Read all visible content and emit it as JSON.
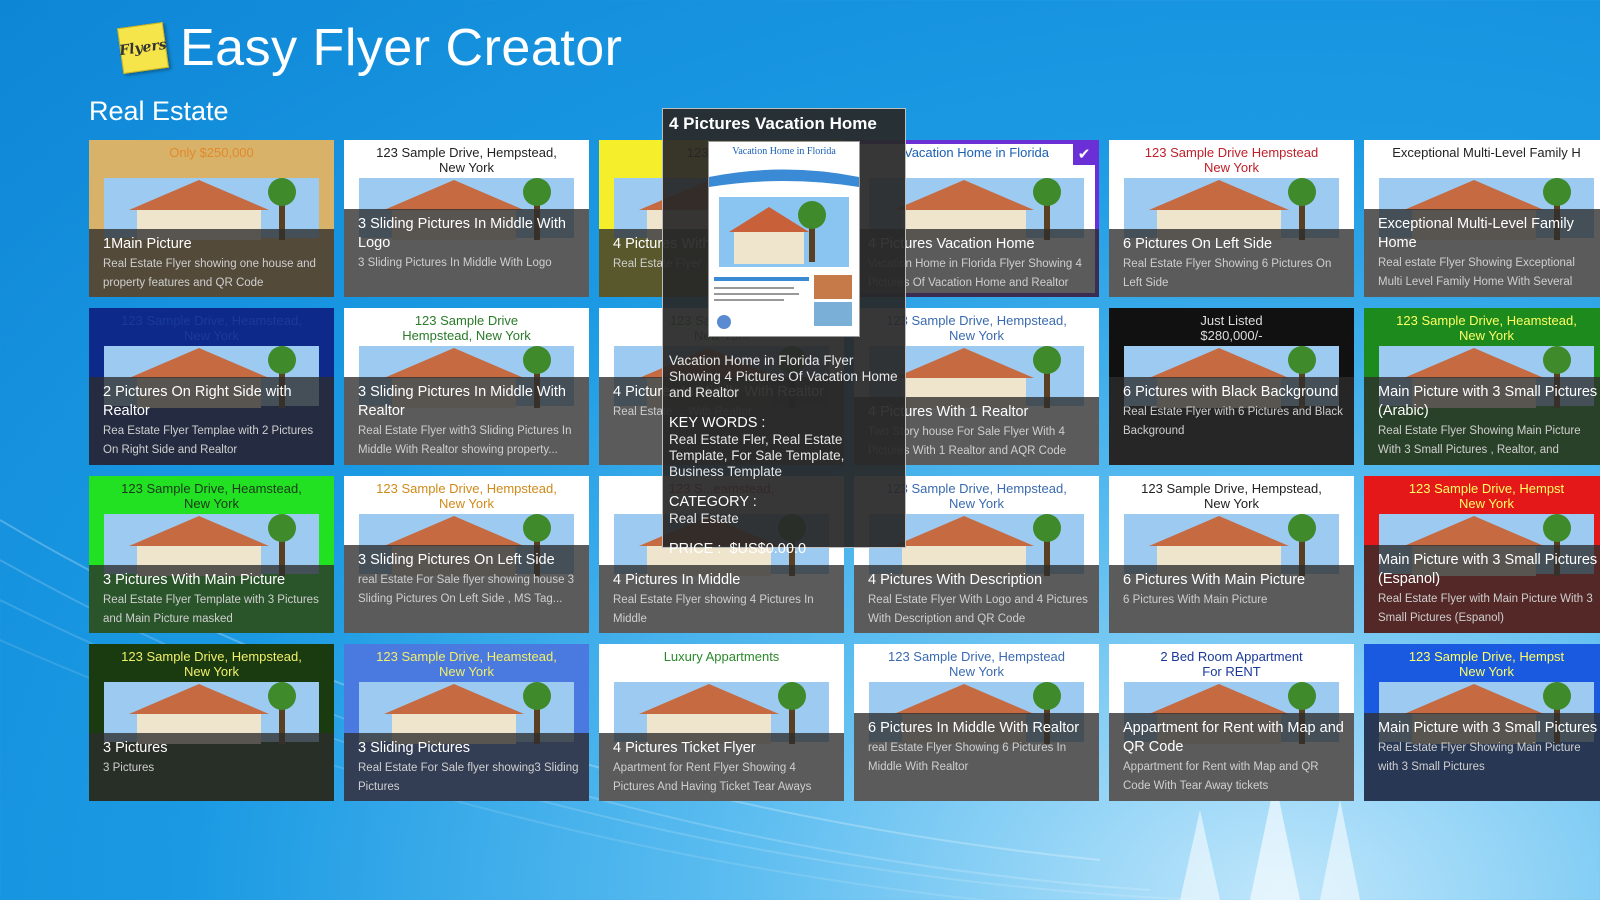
{
  "app": {
    "title": "Easy Flyer Creator",
    "logo_text": "Flyers"
  },
  "section": {
    "title": "Real Estate"
  },
  "tiles": [
    {
      "title": "1Main Picture",
      "desc": "Real Estate Flyer showing one house and property features and QR Code",
      "head": "Only $250,000",
      "bg": "#d9b26a",
      "headColor": "#e08a2a"
    },
    {
      "title": "3 Sliding Pictures In Middle With Logo",
      "desc": "3 Sliding Pictures In Middle With Logo",
      "head": "123 Sample Drive, Hempstead,\nNew York",
      "bg": "#ffffff",
      "headColor": "#222222"
    },
    {
      "title": "4 Pictures With",
      "desc": "Real Estate Flyer ... Logo and",
      "head": "123 Sample",
      "bg": "#f4ef2a",
      "headColor": "#222222"
    },
    {
      "title": "4 Pictures Vacation Home",
      "desc": "Vacation Home in Florida Flyer Showing 4 Pictures Of Vacation Home and Realtor",
      "head": "Vacation Home in Florida",
      "bg": "#ffffff",
      "headColor": "#1a5fb4",
      "selected": true
    },
    {
      "title": "6 Pictures On Left Side",
      "desc": "Real Estate Flyer Showing 6 Pictures On Left Side",
      "head": "123 Sample Drive Hempstead\nNew York",
      "bg": "#ffffff",
      "headColor": "#c0202a"
    },
    {
      "title": "Exceptional Multi-Level Family Home",
      "desc": "Real estate Flyer Showing Exceptional Multi Level Family Home With Several",
      "head": "Exceptional Multi-Level Family H",
      "bg": "#ffffff",
      "headColor": "#222222"
    },
    {
      "title": "2 Pictures On Right Side with Realtor",
      "desc": "Rea Estate Flyer Templae with 2 Pictures On Right Side and Realtor",
      "head": "123 Sample Drive, Heamstead,\nNew York",
      "bg": "#0d2a8a",
      "headColor": "#1a3a9a"
    },
    {
      "title": "3 Sliding Pictures In Middle With Realtor",
      "desc": "Real Estate Flyer with3 Sliding Pictures In Middle With Realtor showing property...",
      "head": "123 Sample Drive\nHempstead, New York",
      "bg": "#ffffff",
      "headColor": "#2a7a2a"
    },
    {
      "title": "4 Pictures In Middle With Realtor",
      "desc": "Real Estate ... With Realtor",
      "head": "123 Sample Drive\nNew York",
      "bg": "#ffffff",
      "headColor": "#2a7a2a"
    },
    {
      "title": "4 Pictures With 1 Realtor",
      "desc": "Two Story house For Sale Flyer With 4 Pictures With 1 Realtor and AQR Code",
      "head": "123 Sample Drive, Hempstead,\nNew York",
      "bg": "#ffffff",
      "headColor": "#3a6ab0"
    },
    {
      "title": "6 Pictures with Black Background",
      "desc": "Real Estate Flyer with 6 Pictures and Black Background",
      "head": "Just Listed\n$280,000/-",
      "bg": "#111111",
      "headColor": "#dddddd"
    },
    {
      "title": "Main Picture with 3 Small Pictures (Arabic)",
      "desc": "Real Estate Flyer Showing Main Picture With 3 Small Pictures , Realtor, and",
      "head": "123 Sample Drive, Heamstead,\nNew York",
      "bg": "#1c8a1c",
      "headColor": "#ffff66"
    },
    {
      "title": "3 Pictures With Main Picture",
      "desc": "Real Estate Flyer Template with 3 Pictures and Main Picture masked",
      "head": "123 Sample Drive, Heamstead,\nNew York",
      "bg": "#22e022",
      "headColor": "#1a3a1a"
    },
    {
      "title": "3 Sliding Pictures On Left Side",
      "desc": "real Estate For Sale flyer showing house 3 Sliding Pictures On Left Side , MS Tag...",
      "head": "123 Sample Drive, Hempstead,\nNew York",
      "bg": "#ffffff",
      "headColor": "#d08a1a"
    },
    {
      "title": "4 Pictures In Middle",
      "desc": "Real Estate Flyer showing 4 Pictures In Middle",
      "head": "123 S...eamstead,",
      "bg": "#ffffff",
      "headColor": "#c0202a"
    },
    {
      "title": "4 Pictures With Description",
      "desc": "Real Estate Flyer With Logo and 4 Pictures With Description and QR Code",
      "head": "123 Sample Drive, Hempstead,\nNew York",
      "bg": "#ffffff",
      "headColor": "#3a6ab0"
    },
    {
      "title": "6 Pictures With Main Picture",
      "desc": "6 Pictures With Main Picture",
      "head": "123 Sample Drive, Hempstead,\nNew York",
      "bg": "#ffffff",
      "headColor": "#222222"
    },
    {
      "title": "Main Picture with 3 Small Pictures (Espanol)",
      "desc": "Real Estate Flyer with Main Picture With 3 Small Pictures (Espanol)",
      "head": "123 Sample Drive, Hempst\nNew York",
      "bg": "#e41818",
      "headColor": "#ffff66"
    },
    {
      "title": "3 Pictures",
      "desc": "3 Pictures",
      "head": "123 Sample Drive, Hempstead,\nNew York",
      "bg": "#1a3a10",
      "headColor": "#f2ef6a"
    },
    {
      "title": "3 Sliding Pictures",
      "desc": "Real Estate For Sale flyer showing3 Sliding Pictures",
      "head": "123 Sample Drive, Heamstead,\nNew York",
      "bg": "#4a7ae0",
      "headColor": "#f2ef6a"
    },
    {
      "title": "4 Pictures Ticket Flyer",
      "desc": "Apartment for Rent Flyer Showing 4 Pictures And Having Ticket Tear Aways",
      "head": "Luxury Appartments",
      "bg": "#ffffff",
      "headColor": "#2a8a2a"
    },
    {
      "title": "6 Pictures In Middle With Realtor",
      "desc": "real Estate Flyer Showing 6 Pictures In Middle With Realtor",
      "head": "123 Sample Drive, Hempstead\nNew York",
      "bg": "#ffffff",
      "headColor": "#3a6ab0"
    },
    {
      "title": "Appartment for Rent with Map and QR Code",
      "desc": "Appartment for Rent with Map and QR Code With Tear Away tickets",
      "head": "2 Bed Room Appartment\nFor RENT",
      "bg": "#ffffff",
      "headColor": "#1a3a9a"
    },
    {
      "title": "Main Picture with 3 Small Pictures",
      "desc": "Real Estate Flyer Showing Main Picture with 3 Small Pictures",
      "head": "123 Sample Drive, Hempst\nNew York",
      "bg": "#1a5ae0",
      "headColor": "#ffff66"
    }
  ],
  "tooltip": {
    "title": "4 Pictures Vacation Home",
    "thumb_head": "Vacation Home in Florida",
    "description": "Vacation Home in Florida Flyer Showing 4 Pictures Of Vacation Home and Realtor",
    "keywords_label": "KEY WORDS :",
    "keywords": "Real Estate Fler, Real Estate Template, For Sale Template, Business Template",
    "category_label": "CATEGORY :",
    "category": "Real Estate",
    "price_label": "PRICE :",
    "price": "$US$0.00.0"
  }
}
